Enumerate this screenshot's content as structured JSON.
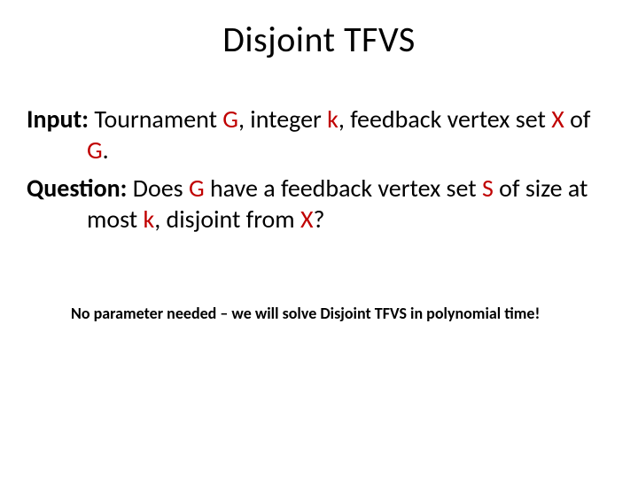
{
  "slide": {
    "title": "Disjoint TFVS",
    "input": {
      "label": "Input: ",
      "t1": "Tournament ",
      "G1": "G",
      "t2": ", integer ",
      "k1": "k",
      "t3": ", feedback vertex set ",
      "X1": "X",
      "t4": " of ",
      "G2": "G",
      "t5": "."
    },
    "question": {
      "label": "Question: ",
      "t1": "Does ",
      "G": "G",
      "t2": " have a feedback vertex set ",
      "S": "S",
      "t3": " of size at most ",
      "k": "k",
      "t4": ", disjoint from ",
      "X": "X",
      "t5": "?"
    },
    "note": "No parameter needed – we will solve Disjoint TFVS in polynomial time!"
  }
}
